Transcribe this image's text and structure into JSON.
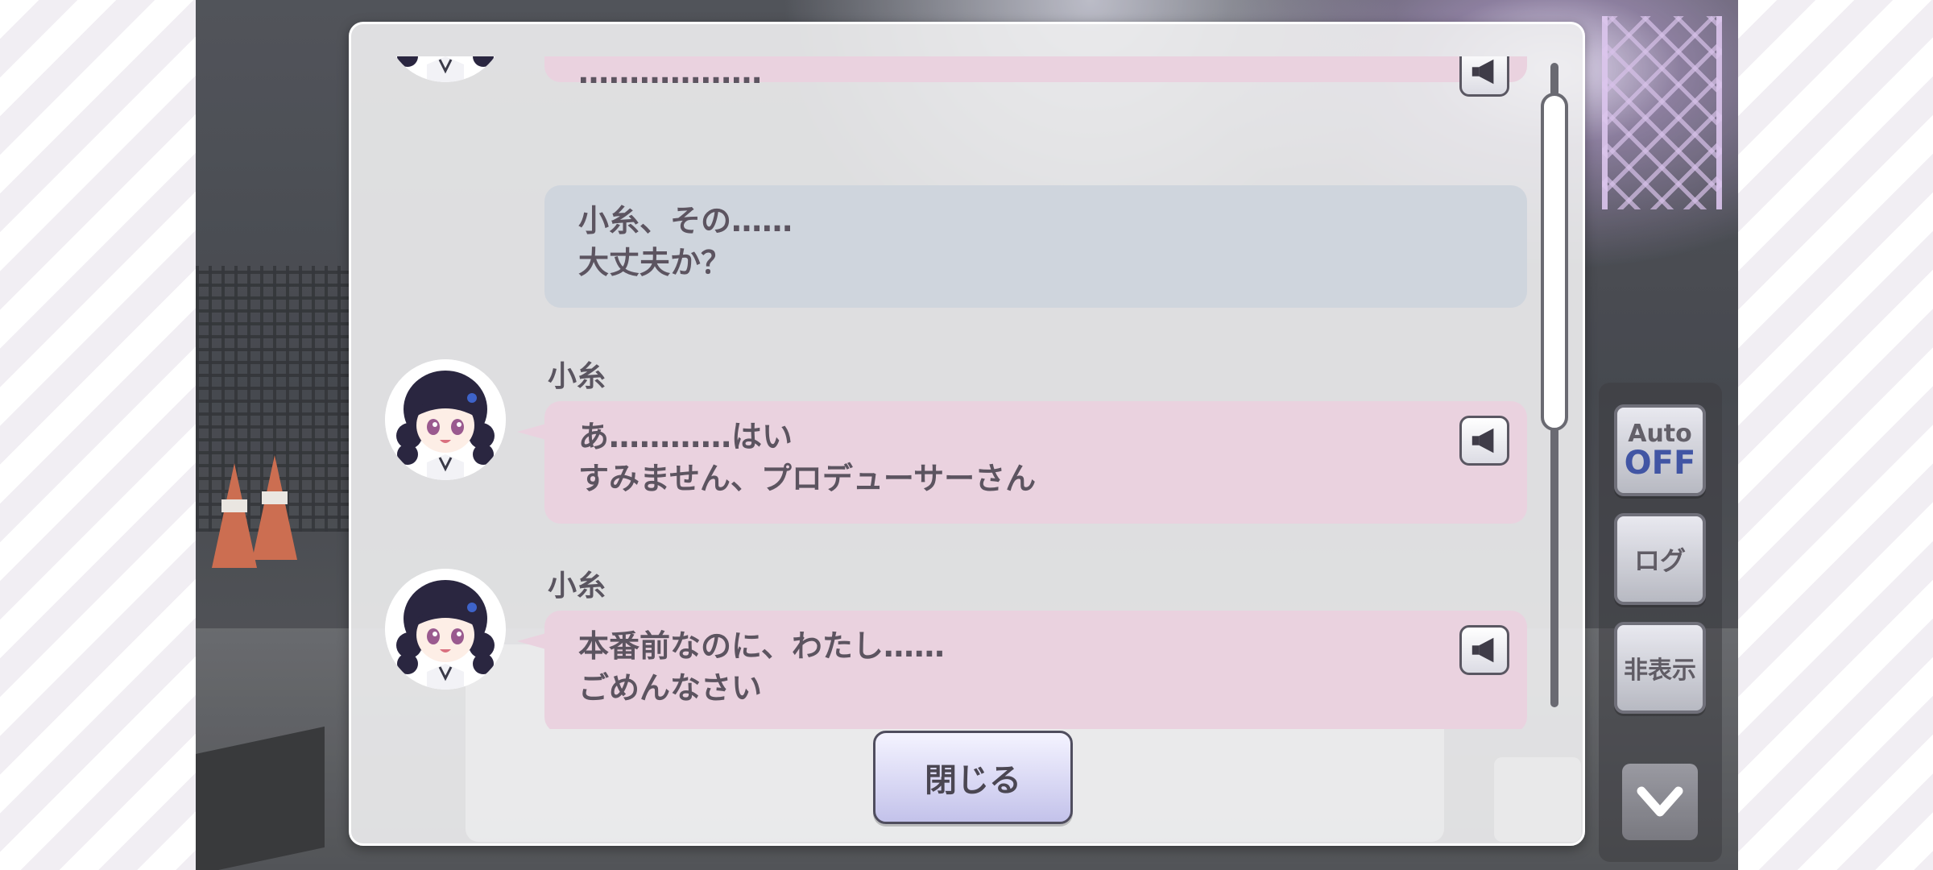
{
  "log": {
    "entries": [
      {
        "kind": "idol",
        "speaker": "",
        "lines": [
          "………………"
        ],
        "has_voice": true
      },
      {
        "kind": "producer",
        "speaker": "",
        "lines": [
          "小糸、その……",
          "大丈夫か？"
        ],
        "has_voice": false
      },
      {
        "kind": "idol",
        "speaker": "小糸",
        "lines": [
          "あ…………はい",
          "すみません、プロデューサーさん"
        ],
        "has_voice": true
      },
      {
        "kind": "idol",
        "speaker": "小糸",
        "lines": [
          "本番前なのに、わたし……",
          "ごめんなさい"
        ],
        "has_voice": true
      }
    ],
    "close_label": "閉じる"
  },
  "controls": {
    "auto_label": "Auto",
    "auto_state": "OFF",
    "log_label": "ログ",
    "hide_label": "非表示"
  },
  "colors": {
    "idol_bubble": "#ead2df",
    "producer_bubble": "#cfd5dd",
    "auto_off_accent": "#273e98"
  },
  "icons": {
    "voice": "speaker-play-icon",
    "down": "chevron-down-icon"
  }
}
